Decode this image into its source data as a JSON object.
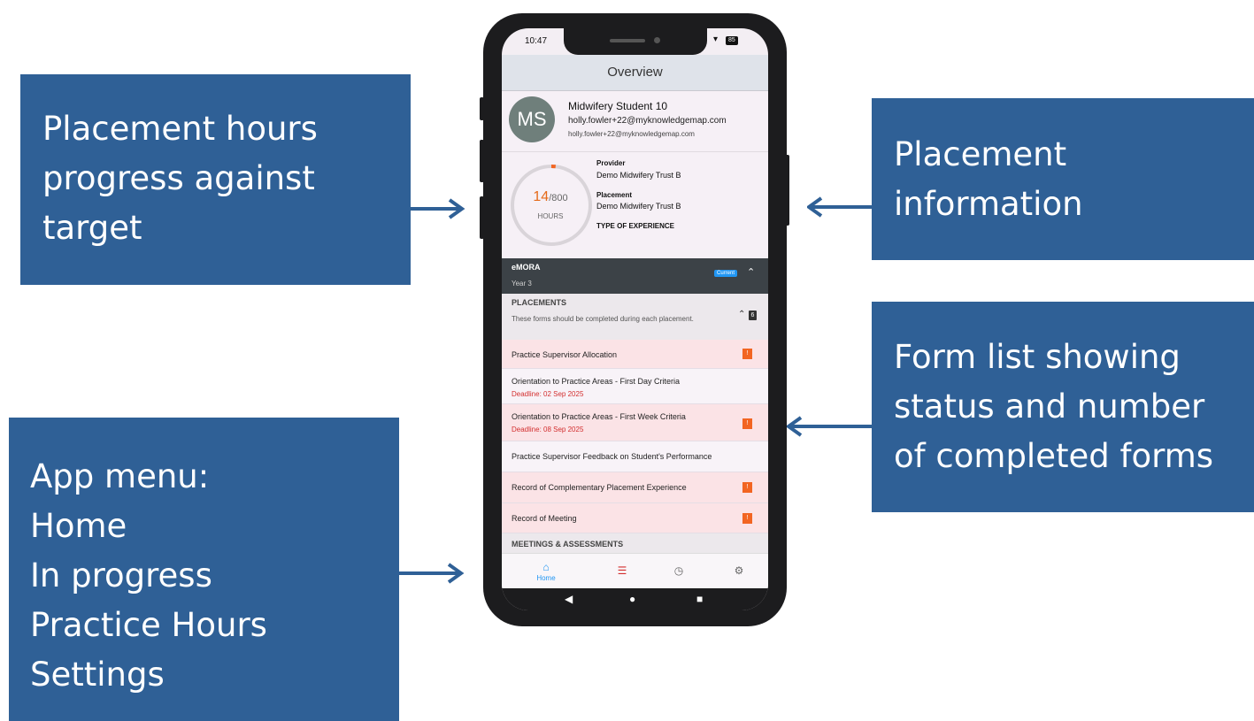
{
  "callouts": {
    "left_top": [
      "Placement hours",
      "progress against",
      "target"
    ],
    "right_top": [
      "Placement",
      "information"
    ],
    "right_middle": [
      "Form list showing",
      "status and number",
      "of completed forms"
    ],
    "left_bottom": [
      "App menu:",
      "Home",
      "In progress",
      "Practice Hours",
      "Settings"
    ]
  },
  "colors": {
    "callout_bg": "#2f6096",
    "alert_row": "#fbe3e6",
    "flag": "#f26522",
    "accent": "#2196f3"
  },
  "status": {
    "time": "10:47",
    "battery": "85"
  },
  "appbar": {
    "title": "Overview"
  },
  "profile": {
    "initials": "MS",
    "name": "Midwifery Student 10",
    "email": "holly.fowler+22@myknowledgemap.com",
    "email_secondary": "holly.fowler+22@myknowledgemap.com"
  },
  "hours": {
    "completed": "14",
    "target": "/800",
    "label": "HOURS",
    "progress_fraction": 0.0175
  },
  "placement": {
    "provider_label": "Provider",
    "provider": "Demo Midwifery Trust B",
    "placement_label": "Placement",
    "placement": "Demo Midwifery Trust B",
    "experience_label": "TYPE OF EXPERIENCE"
  },
  "course": {
    "name": "eMORA",
    "year": "Year 3",
    "badge": "Current"
  },
  "placements_section": {
    "title": "PLACEMENTS",
    "description": "These forms should be completed during each placement.",
    "count": "6"
  },
  "forms": [
    {
      "title": "Practice Supervisor Allocation",
      "deadline": "",
      "flag": "!"
    },
    {
      "title": "Orientation to Practice Areas - First Day Criteria",
      "deadline": "Deadline: 02 Sep 2025",
      "flag": ""
    },
    {
      "title": "Orientation to Practice Areas - First Week Criteria",
      "deadline": "Deadline: 08 Sep 2025",
      "flag": "!"
    },
    {
      "title": "Practice Supervisor Feedback on Student's Performance",
      "deadline": "",
      "flag": ""
    },
    {
      "title": "Record of Complementary Placement Experience",
      "deadline": "",
      "flag": "!"
    },
    {
      "title": "Record of Meeting",
      "deadline": "",
      "flag": "!"
    }
  ],
  "meetings_section": {
    "title": "MEETINGS & ASSESSMENTS"
  },
  "nav": {
    "home_label": "Home",
    "icons": [
      "home-icon",
      "in-progress-icon",
      "clock-icon",
      "gear-icon"
    ]
  },
  "system_nav": [
    "back-icon",
    "home-circle-icon",
    "recents-icon"
  ]
}
